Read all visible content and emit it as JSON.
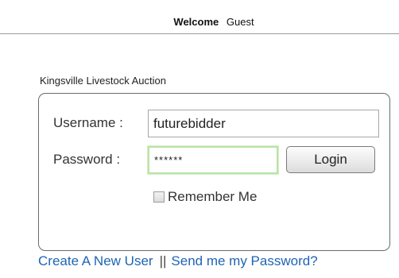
{
  "header": {
    "welcome_label": "Welcome",
    "user_name": "Guest"
  },
  "login": {
    "section_title": "Kingsville Livestock Auction",
    "username_label": "Username :",
    "username_value": "futurebidder",
    "password_label": "Password :",
    "password_value": "******",
    "login_button": "Login",
    "remember_label": "Remember Me",
    "remember_checked": false
  },
  "links": {
    "create_user": "Create A New User",
    "separator": "||",
    "send_password": "Send me my Password?"
  },
  "colors": {
    "link": "#1f64b4",
    "focus_border": "#b9e3a6",
    "box_border": "#6b6b6b"
  }
}
